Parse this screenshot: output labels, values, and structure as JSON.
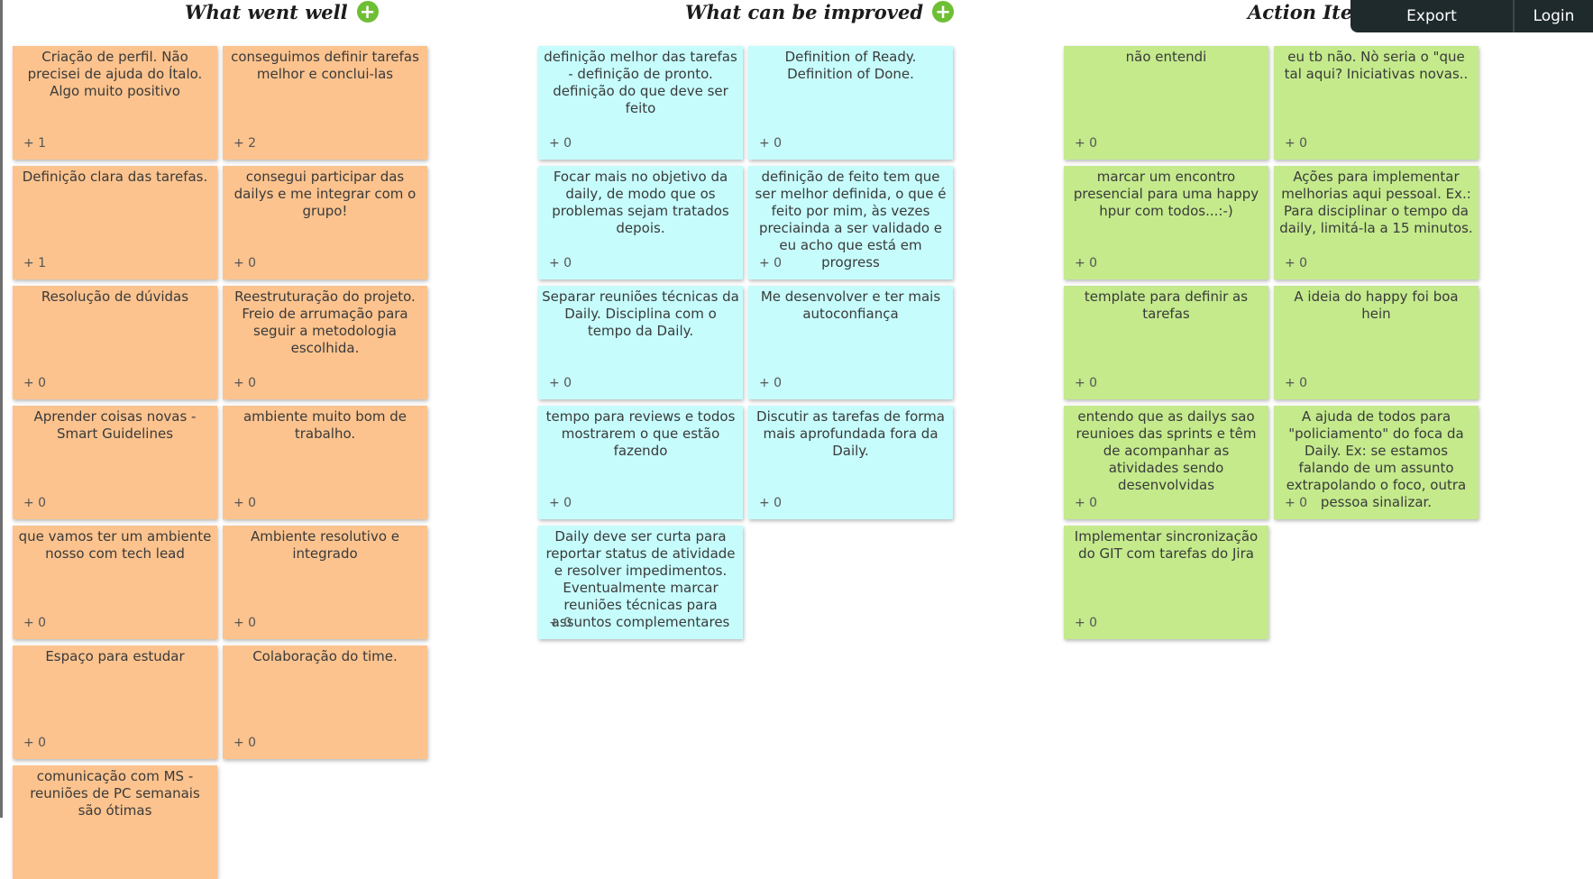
{
  "headers": {
    "went_well": "What went well",
    "improve": "What can be improved",
    "actions": "Action Items",
    "add_symbol": "+"
  },
  "topbar": {
    "export": "Export",
    "login": "Login"
  },
  "colors": {
    "went_well": "#fcc38e",
    "improve": "#c6fcfc",
    "actions": "#c4ea8c",
    "add_button": "#6fbf35",
    "topbar": "#1f2a2d"
  },
  "columns": {
    "went_well": [
      [
        {
          "text": "Criação de perfil. Não precisei de ajuda do Ítalo. Algo muito positivo",
          "votes": "+ 1"
        },
        {
          "text": "conseguimos definir tarefas melhor e conclui-las",
          "votes": "+ 2"
        }
      ],
      [
        {
          "text": "Definição clara das tarefas.",
          "votes": "+ 1"
        },
        {
          "text": "consegui participar das dailys e me integrar com o grupo!",
          "votes": "+ 0"
        }
      ],
      [
        {
          "text": "Resolução de dúvidas",
          "votes": "+ 0"
        },
        {
          "text": "Reestruturação do projeto. Freio de arrumação para seguir a metodologia escolhida.",
          "votes": "+ 0"
        }
      ],
      [
        {
          "text": "Aprender coisas novas - Smart Guidelines",
          "votes": "+ 0"
        },
        {
          "text": "ambiente muito bom de trabalho.",
          "votes": "+ 0"
        }
      ],
      [
        {
          "text": "que vamos ter um ambiente nosso com tech lead",
          "votes": "+ 0"
        },
        {
          "text": "Ambiente resolutivo e integrado",
          "votes": "+ 0"
        }
      ],
      [
        {
          "text": "Espaço para estudar",
          "votes": "+ 0"
        },
        {
          "text": "Colaboração do time.",
          "votes": "+ 0"
        }
      ],
      [
        {
          "text": "comunicação com MS - reuniões de PC semanais são ótimas",
          "votes": ""
        }
      ]
    ],
    "improve": [
      [
        {
          "text": "definição melhor das tarefas - definição de pronto. definição do que deve ser feito",
          "votes": "+ 0"
        },
        {
          "text": "Definition of Ready. Definition of Done.",
          "votes": "+ 0"
        }
      ],
      [
        {
          "text": "Focar mais no objetivo da daily, de modo que os problemas sejam tratados depois.",
          "votes": "+ 0"
        },
        {
          "text": "definição de feito tem que ser melhor definida, o que é feito por mim, às vezes preciainda a ser validado e eu acho que está em progress",
          "votes": "+ 0"
        }
      ],
      [
        {
          "text": "Separar reuniões técnicas da Daily. Disciplina com o tempo da Daily.",
          "votes": "+ 0"
        },
        {
          "text": "Me desenvolver e ter mais autoconfiança",
          "votes": "+ 0"
        }
      ],
      [
        {
          "text": "tempo para reviews e todos mostrarem o que estão fazendo",
          "votes": "+ 0"
        },
        {
          "text": "Discutir as tarefas de forma mais aprofundada fora da Daily.",
          "votes": "+ 0"
        }
      ],
      [
        {
          "text": "Daily deve ser curta para reportar status de atividade e resolver impedimentos. Eventualmente marcar reuniões técnicas para assuntos complementares",
          "votes": "+ 0"
        }
      ]
    ],
    "actions": [
      [
        {
          "text": "não entendi",
          "votes": "+ 0"
        },
        {
          "text": "eu tb não. Nò seria o \"que tal aqui? Iniciativas novas..",
          "votes": "+ 0"
        }
      ],
      [
        {
          "text": "marcar um encontro presencial para uma happy hpur com todos...:-)",
          "votes": "+ 0"
        },
        {
          "text": "Ações para implementar melhorias aqui pessoal. Ex.: Para disciplinar o tempo da daily, limitá-la a 15 minutos.",
          "votes": "+ 0"
        }
      ],
      [
        {
          "text": "template para definir as tarefas",
          "votes": "+ 0"
        },
        {
          "text": "A ideia do happy foi boa hein",
          "votes": "+ 0"
        }
      ],
      [
        {
          "text": "entendo que as dailys sao reunioes das sprints e têm de acompanhar as atividades sendo desenvolvidas",
          "votes": "+ 0"
        },
        {
          "text": "A ajuda de todos para \"policiamento\" do foca da Daily. Ex: se estamos falando de um assunto extrapolando o foco, outra pessoa sinalizar.",
          "votes": "+ 0"
        }
      ],
      [
        {
          "text": "Implementar sincronização do GIT com tarefas do Jira",
          "votes": "+ 0"
        }
      ]
    ]
  }
}
